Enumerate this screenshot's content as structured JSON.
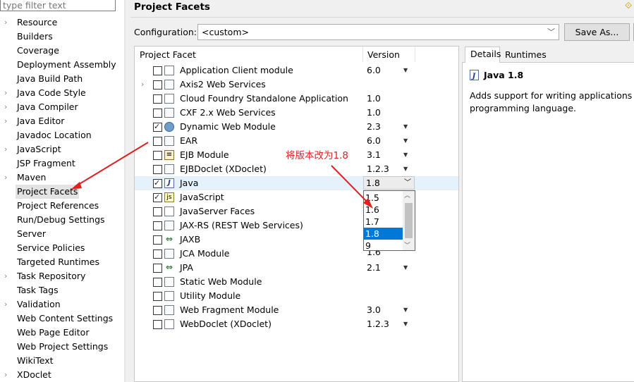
{
  "filter": {
    "placeholder": "type filter text"
  },
  "tree": [
    {
      "label": "Resource",
      "expandable": true
    },
    {
      "label": "Builders",
      "expandable": false
    },
    {
      "label": "Coverage",
      "expandable": false
    },
    {
      "label": "Deployment Assembly",
      "expandable": false
    },
    {
      "label": "Java Build Path",
      "expandable": false
    },
    {
      "label": "Java Code Style",
      "expandable": true
    },
    {
      "label": "Java Compiler",
      "expandable": true
    },
    {
      "label": "Java Editor",
      "expandable": true
    },
    {
      "label": "Javadoc Location",
      "expandable": false
    },
    {
      "label": "JavaScript",
      "expandable": true
    },
    {
      "label": "JSP Fragment",
      "expandable": false
    },
    {
      "label": "Maven",
      "expandable": true
    },
    {
      "label": "Project Facets",
      "expandable": false,
      "selected": true
    },
    {
      "label": "Project References",
      "expandable": false
    },
    {
      "label": "Run/Debug Settings",
      "expandable": false
    },
    {
      "label": "Server",
      "expandable": false
    },
    {
      "label": "Service Policies",
      "expandable": false
    },
    {
      "label": "Targeted Runtimes",
      "expandable": false
    },
    {
      "label": "Task Repository",
      "expandable": true
    },
    {
      "label": "Task Tags",
      "expandable": false
    },
    {
      "label": "Validation",
      "expandable": true
    },
    {
      "label": "Web Content Settings",
      "expandable": false
    },
    {
      "label": "Web Page Editor",
      "expandable": false
    },
    {
      "label": "Web Project Settings",
      "expandable": false
    },
    {
      "label": "WikiText",
      "expandable": false
    },
    {
      "label": "XDoclet",
      "expandable": true
    }
  ],
  "page": {
    "title": "Project Facets"
  },
  "config": {
    "label": "Configuration:",
    "value": "<custom>",
    "save_as": "Save As..."
  },
  "table": {
    "col_facet": "Project Facet",
    "col_version": "Version"
  },
  "facets": [
    {
      "name": "Application Client module",
      "checked": false,
      "icon": "page-icon",
      "version": "6.0",
      "dropdown": true
    },
    {
      "name": "Axis2 Web Services",
      "checked": false,
      "icon": "page-icon",
      "version": "",
      "dropdown": false,
      "expandable": true
    },
    {
      "name": "Cloud Foundry Standalone Application",
      "checked": false,
      "icon": "page-icon",
      "version": "1.0",
      "dropdown": false
    },
    {
      "name": "CXF 2.x Web Services",
      "checked": false,
      "icon": "page-icon",
      "version": "1.0",
      "dropdown": false
    },
    {
      "name": "Dynamic Web Module",
      "checked": true,
      "icon": "globe-icon",
      "version": "2.3",
      "dropdown": true
    },
    {
      "name": "EAR",
      "checked": false,
      "icon": "page-icon",
      "version": "6.0",
      "dropdown": true
    },
    {
      "name": "EJB Module",
      "checked": false,
      "icon": "jar-icon",
      "version": "3.1",
      "dropdown": true
    },
    {
      "name": "EJBDoclet (XDoclet)",
      "checked": false,
      "icon": "page-icon",
      "version": "1.2.3",
      "dropdown": true
    },
    {
      "name": "Java",
      "checked": true,
      "icon": "java-icon",
      "version": "",
      "dropdown": false,
      "selected": true
    },
    {
      "name": "JavaScript",
      "checked": true,
      "icon": "js-icon",
      "version": "",
      "dropdown": false
    },
    {
      "name": "JavaServer Faces",
      "checked": false,
      "icon": "page-icon",
      "version": "",
      "dropdown": false
    },
    {
      "name": "JAX-RS (REST Web Services)",
      "checked": false,
      "icon": "page-icon",
      "version": "",
      "dropdown": false
    },
    {
      "name": "JAXB",
      "checked": false,
      "icon": "arrows-icon",
      "version": "",
      "dropdown": false
    },
    {
      "name": "JCA Module",
      "checked": false,
      "icon": "page-icon",
      "version": "",
      "dropdown": false
    },
    {
      "name": "JPA",
      "checked": false,
      "icon": "arrows-icon",
      "version": "2.1",
      "dropdown": true
    },
    {
      "name": "Static Web Module",
      "checked": false,
      "icon": "page-icon",
      "version": "",
      "dropdown": false
    },
    {
      "name": "Utility Module",
      "checked": false,
      "icon": "page-icon",
      "version": "",
      "dropdown": false
    },
    {
      "name": "Web Fragment Module",
      "checked": false,
      "icon": "page-icon",
      "version": "3.0",
      "dropdown": true
    },
    {
      "name": "WebDoclet (XDoclet)",
      "checked": false,
      "icon": "page-icon",
      "version": "1.2.3",
      "dropdown": true
    }
  ],
  "version_combo": {
    "value": "1.8",
    "options": [
      "1.5",
      "1.6",
      "1.7",
      "1.8",
      "9"
    ],
    "selected": "1.8",
    "partial_row_version": "1.6"
  },
  "tabs": {
    "details": "Details",
    "runtimes": "Runtimes"
  },
  "details": {
    "title": "Java 1.8",
    "desc_line1": "Adds support for writing applications us",
    "desc_line2": "programming language."
  },
  "annotation": {
    "text": "将版本改为1.8",
    "color": "#e02020"
  }
}
